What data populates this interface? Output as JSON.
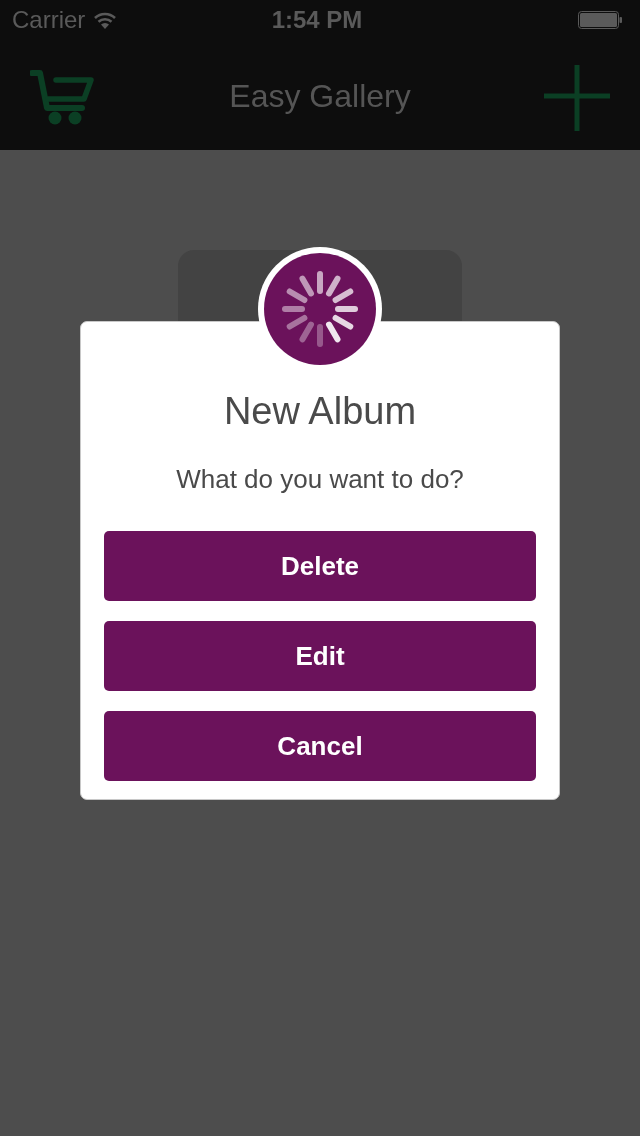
{
  "status_bar": {
    "carrier": "Carrier",
    "time": "1:54 PM"
  },
  "nav_bar": {
    "title": "Easy Gallery"
  },
  "dialog": {
    "title": "New Album",
    "message": "What do you want to do?",
    "buttons": [
      "Delete",
      "Edit",
      "Cancel"
    ]
  }
}
